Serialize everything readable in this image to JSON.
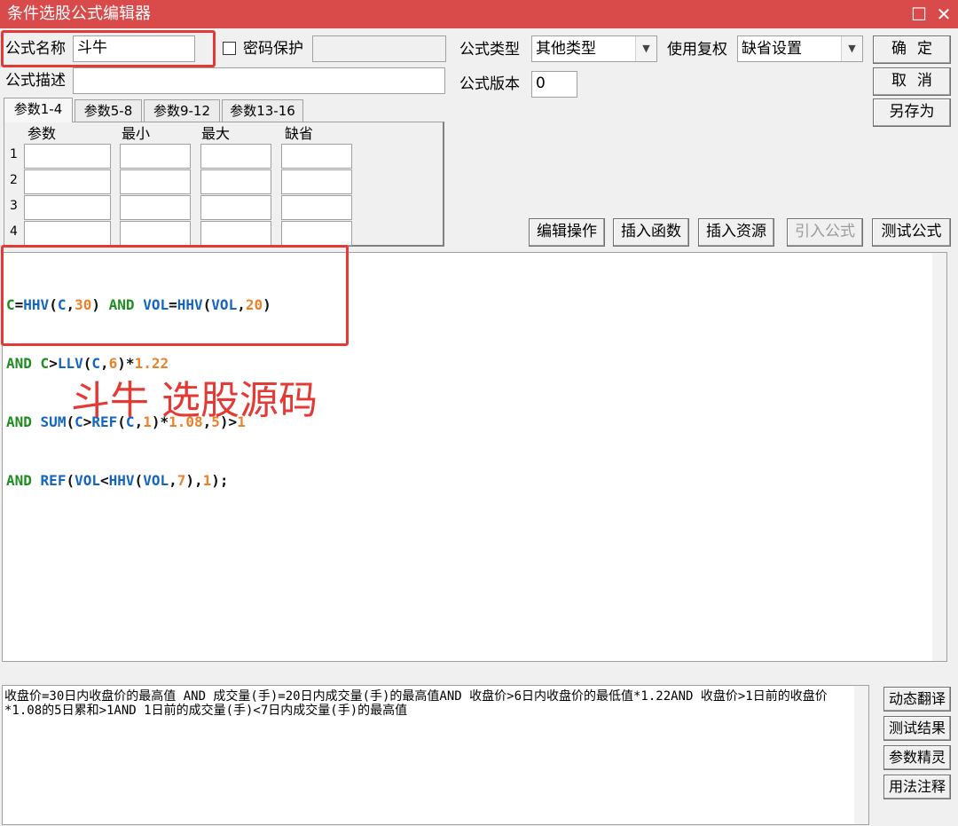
{
  "window": {
    "title": "条件选股公式编辑器",
    "maximize_glyph": "☐",
    "close_glyph": "✕"
  },
  "form": {
    "name_label": "公式名称",
    "name_value": "斗牛",
    "password_label": "密码保护",
    "password_value": "",
    "desc_label": "公式描述",
    "desc_value": "",
    "type_label": "公式类型",
    "type_value": "其他类型",
    "restore_label": "使用复权",
    "restore_value": "缺省设置",
    "version_label": "公式版本",
    "version_value": "0"
  },
  "buttons": {
    "ok": "确定",
    "cancel": "取消",
    "save_as": "另存为",
    "edit_ops": "编辑操作",
    "insert_func": "插入函数",
    "insert_resource": "插入资源",
    "import_formula": "引入公式",
    "test_formula": "测试公式"
  },
  "params": {
    "tabs": [
      "参数1-4",
      "参数5-8",
      "参数9-12",
      "参数13-16"
    ],
    "headers": [
      "参数",
      "最小",
      "最大",
      "缺省"
    ],
    "rows": [
      "1",
      "2",
      "3",
      "4"
    ]
  },
  "code": {
    "lines": [
      "C=HHV(C,30) AND VOL=HHV(VOL,20)",
      "AND C>LLV(C,6)*1.22",
      "AND SUM(C>REF(C,1)*1.08,5)>1",
      "AND REF(VOL<HHV(VOL,7),1);"
    ]
  },
  "annotation": "斗牛 选股源码",
  "translation": {
    "text": "收盘价=30日内收盘价的最高值 AND 成交量(手)=20日内成交量(手)的最高值AND 收盘价>6日内收盘价的最低值*1.22AND 收盘价>1日前的收盘价*1.08的5日累和>1AND 1日前的成交量(手)<7日内成交量(手)的最高值"
  },
  "side_buttons": {
    "dynamic_translate": "动态翻译",
    "test_result": "测试结果",
    "param_wizard": "参数精灵",
    "usage_notes": "用法注释"
  },
  "colors": {
    "titlebar": "#d94a4a",
    "highlight": "#e53935",
    "keyword": "#1e8c1e",
    "function": "#1565c0",
    "number": "#e8822a"
  },
  "icons": {
    "dropdown": "chevron-down-icon",
    "window": [
      "maximize-icon",
      "close-icon"
    ]
  }
}
